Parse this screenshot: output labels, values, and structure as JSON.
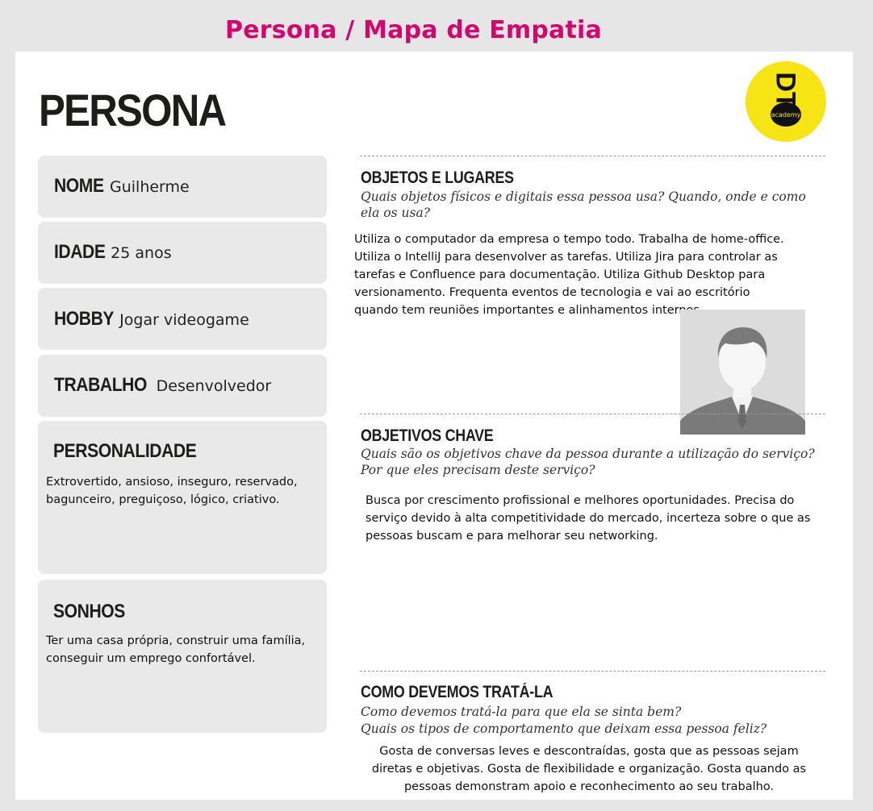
{
  "page": {
    "title": "Persona / Mapa de Empatia"
  },
  "card": {
    "heading": "PERSONA"
  },
  "logo": {
    "mark": "DT",
    "tag": "academy"
  },
  "profile": {
    "nome": {
      "label": "NOME",
      "value": "Guilherme"
    },
    "idade": {
      "label": "IDADE",
      "value": "25 anos"
    },
    "hobby": {
      "label": "HOBBY",
      "value": "Jogar videogame"
    },
    "trabalho": {
      "label": "TRABALHO",
      "value": "Desenvolvedor"
    },
    "personalidade": {
      "label": "PERSONALIDADE",
      "text": "Extrovertido, ansioso, inseguro, reservado, bagunceiro, preguiçoso, lógico, criativo."
    },
    "sonhos": {
      "label": "SONHOS",
      "text": "Ter uma casa própria, construir uma família, conseguir um emprego confortável."
    }
  },
  "sections": {
    "objetos": {
      "title": "OBJETOS E LUGARES",
      "question": "Quais objetos físicos e digitais essa pessoa usa? Quando, onde e como ela os usa?",
      "body": "Utiliza o computador da empresa o tempo todo. Trabalha de home-office. Utiliza o IntelliJ para desenvolver as tarefas. Utiliza Jira para controlar as tarefas e Confluence para documentação. Utiliza Github Desktop para versionamento. Frequenta eventos de tecnologia e vai ao escritório quando tem reuniões importantes e alinhamentos internos."
    },
    "objetivos": {
      "title": "OBJETIVOS CHAVE",
      "question": "Quais são os objetivos chave da pessoa durante a utilização do serviço? Por que eles precisam deste serviço?",
      "body": "Busca por crescimento profissional e melhores oportunidades. Precisa do serviço devido à alta competitividade do mercado, incerteza sobre o que as pessoas buscam e para melhorar seu networking."
    },
    "tratamento": {
      "title": "COMO DEVEMOS TRATÁ-LA",
      "question1": "Como devemos tratá-la para que ela se sinta bem?",
      "question2": "Quais os tipos de comportamento que deixam essa pessoa feliz?",
      "body": "Gosta de conversas leves e descontraídas, gosta que as pessoas sejam diretas e objetivas. Gosta de flexibilidade e organização. Gosta quando as pessoas demonstram apoio e reconhecimento ao seu trabalho."
    }
  },
  "colors": {
    "title": "#d4066e",
    "logo": "#f7e414",
    "box": "#e9e9e9"
  },
  "icons": {
    "photo": "avatar-placeholder-icon"
  }
}
